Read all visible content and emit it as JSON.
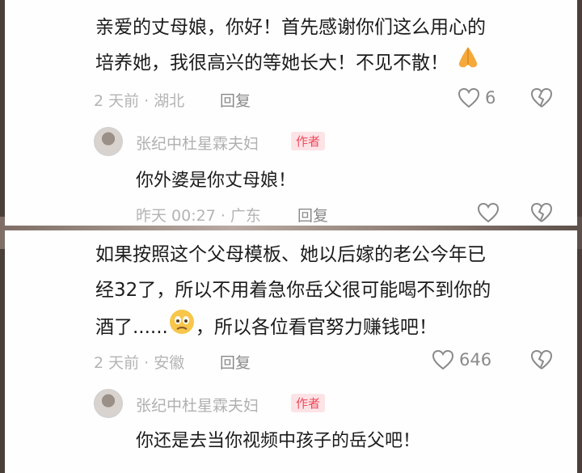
{
  "comment1": {
    "line1": "亲爱的丈母娘，你好！首先感谢你们这么用心的",
    "line2": "培养她，我很高兴的等她长大！不见不散！",
    "time_location": "2 天前 · 湖北",
    "reply_label": "回复",
    "like_count": "6"
  },
  "reply1": {
    "author": "张纪中杜星霖夫妇",
    "badge": "作者",
    "text": "你外婆是你丈母娘！",
    "time_location": "昨天 00:27 · 广东",
    "reply_label": "回复"
  },
  "comment2": {
    "line1": "如果按照这个父母模板、她以后嫁的老公今年已",
    "line2": "经32了，所以不用着急你岳父很可能喝不到你的",
    "line3a": "酒了......",
    "line3b": "，所以各位看官努力赚钱吧！",
    "time_location": "2 天前 · 安徽",
    "reply_label": "回复",
    "like_count": "646"
  },
  "reply2": {
    "author": "张纪中杜星霖夫妇",
    "badge": "作者",
    "text": "你还是去当你视频中孩子的岳父吧！"
  }
}
